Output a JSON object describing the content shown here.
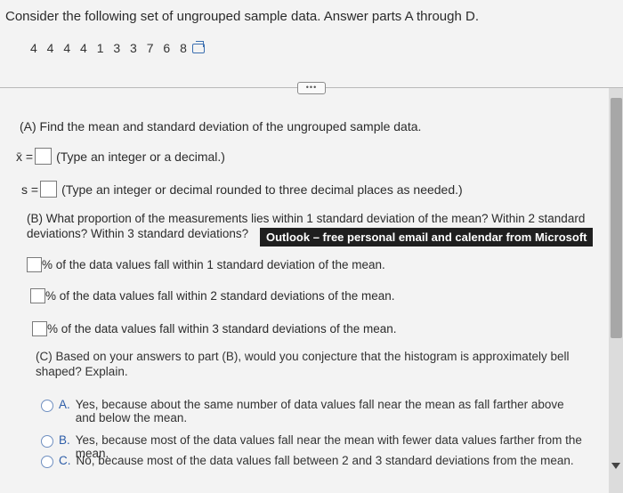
{
  "header": {
    "prompt": "Consider the following set of ungrouped sample data. Answer parts A through D.",
    "data_values": "4 4 4 4 1 3 3 7 6 8"
  },
  "toolbar": {
    "more_label": "•••"
  },
  "part_a": {
    "question": "(A) Find the mean and standard deviation of the ungrouped sample data.",
    "mean_label": "x̄ =",
    "mean_value": "",
    "mean_hint": "(Type an integer or a decimal.)",
    "sd_label": "s =",
    "sd_value": "",
    "sd_hint": "(Type an integer or decimal rounded to three decimal places as needed.)"
  },
  "part_b": {
    "question_line1": "(B) What proportion of the measurements lies within 1 standard deviation of the mean? Within 2 standard",
    "question_line2": "deviations? Within 3 standard deviations?",
    "tooltip": "Outlook – free personal email and calendar from Microsoft",
    "within1": "% of the data values fall within 1 standard deviation of the mean.",
    "within2": "% of the data values fall within 2 standard deviations of the mean.",
    "within3": "% of the data values fall within 3 standard deviations of the mean."
  },
  "part_c": {
    "question": "(C) Based on your answers to part (B), would you conjecture that the histogram is approximately bell shaped? Explain.",
    "options": [
      {
        "letter": "A.",
        "text": "Yes, because about the same number of data values fall near the mean as fall farther above and below the mean."
      },
      {
        "letter": "B.",
        "text": "Yes, because most of the data values fall near the mean with fewer data values farther from the mean."
      },
      {
        "letter": "C.",
        "text": "No, because most of the data values fall between 2 and 3 standard deviations from the mean."
      }
    ]
  },
  "icons": {
    "copy": "copy-icon",
    "radio": "radio-icon"
  }
}
